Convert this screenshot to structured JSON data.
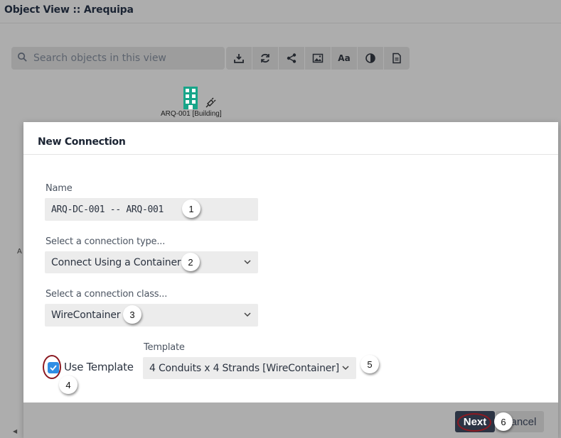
{
  "window": {
    "title": "Object View :: Arequipa"
  },
  "search": {
    "placeholder": "Search objects in this view"
  },
  "toolbar": {
    "buttons": [
      {
        "icon": "download-icon"
      },
      {
        "icon": "refresh-icon"
      },
      {
        "icon": "share-icon"
      },
      {
        "icon": "image-icon"
      },
      {
        "icon": "font-icon",
        "label": "Aa"
      },
      {
        "icon": "contrast-icon"
      },
      {
        "icon": "document-icon"
      }
    ]
  },
  "canvas": {
    "node": {
      "label": "ARQ-001 [Building]"
    },
    "edge_fragment": "A"
  },
  "dialog": {
    "title": "New Connection",
    "name": {
      "label": "Name",
      "value": "ARQ-DC-001 -- ARQ-001"
    },
    "connection_type": {
      "label": "Select a connection type...",
      "value": "Connect Using a Container"
    },
    "connection_class": {
      "label": "Select a connection class...",
      "value": "WireContainer"
    },
    "use_template": {
      "label": "Use Template",
      "checked": true
    },
    "template": {
      "label": "Template",
      "value": "4 Conduits x 4 Strands [WireContainer]"
    },
    "footer": {
      "next_label": "Next",
      "cancel_label": "Cancel"
    }
  },
  "callouts": [
    "1",
    "2",
    "3",
    "4",
    "5",
    "6"
  ],
  "colors": {
    "accent": "#2f8de4",
    "highlight_ring": "#8b1a22",
    "primary_button": "#2c3444",
    "building_icon": "#17a589"
  }
}
